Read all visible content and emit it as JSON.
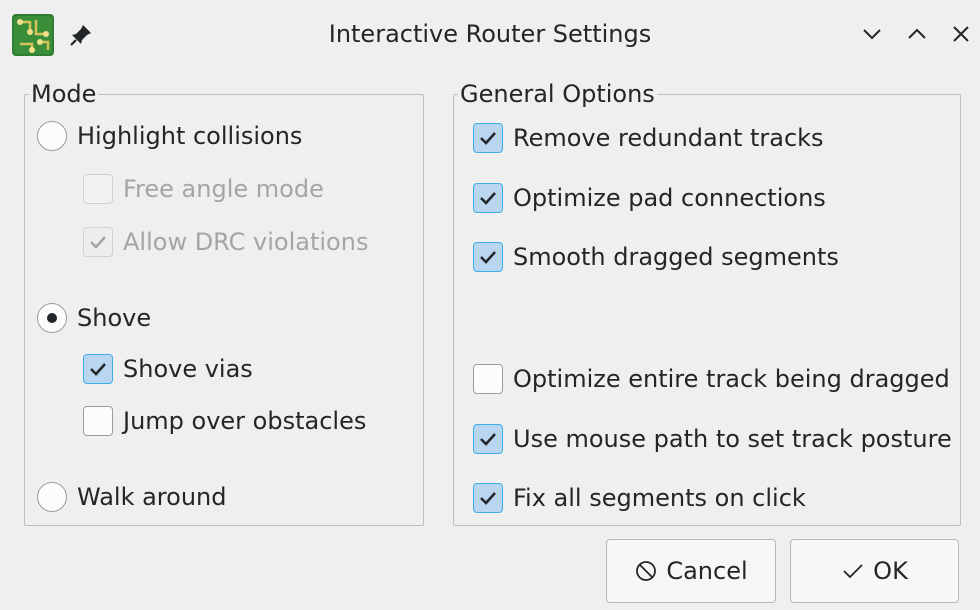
{
  "window": {
    "title": "Interactive Router Settings",
    "icons": [
      "kicad-app-icon",
      "pin-icon",
      "minimize-icon",
      "maximize-icon",
      "close-icon"
    ]
  },
  "mode": {
    "title": "Mode",
    "options": [
      {
        "label": "Highlight collisions",
        "selected": false
      },
      {
        "label": "Shove",
        "selected": true
      },
      {
        "label": "Walk around",
        "selected": false
      }
    ],
    "highlight_sub": [
      {
        "label": "Free angle mode",
        "checked": false,
        "disabled": true
      },
      {
        "label": "Allow DRC violations",
        "checked": true,
        "disabled": true
      }
    ],
    "shove_sub": [
      {
        "label": "Shove vias",
        "checked": true
      },
      {
        "label": "Jump over obstacles",
        "checked": false
      }
    ]
  },
  "general": {
    "title": "General Options",
    "options": [
      {
        "label": "Remove redundant tracks",
        "checked": true
      },
      {
        "label": "Optimize pad connections",
        "checked": true
      },
      {
        "label": "Smooth dragged segments",
        "checked": true
      },
      {
        "label": "Optimize entire track being dragged",
        "checked": false
      },
      {
        "label": "Use mouse path to set track posture",
        "checked": true
      },
      {
        "label": "Fix all segments on click",
        "checked": true
      }
    ]
  },
  "buttons": {
    "cancel": "Cancel",
    "ok": "OK"
  },
  "colors": {
    "accent": "#3daee9",
    "check_fill": "#b9d5ef",
    "background": "#efefef"
  }
}
